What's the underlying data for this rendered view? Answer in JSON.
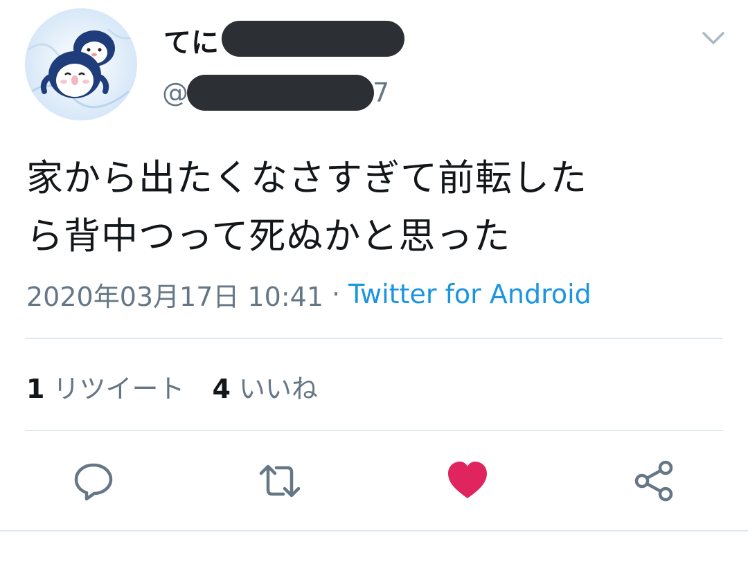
{
  "author": {
    "display_name_visible": "てに",
    "handle_prefix": "@",
    "handle_suffix_visible": "7",
    "avatar_icon": "penguin-avatar-icon"
  },
  "menu_icon": "chevron-down-icon",
  "tweet": {
    "text_line1": "家から出たくなさすぎて前転した",
    "text_line2": "ら背中つって死ぬかと思った",
    "timestamp": "2020年03月17日 10:41",
    "separator": "·",
    "source": "Twitter for Android"
  },
  "stats": {
    "retweets_count": "1",
    "retweets_label": "リツイート",
    "likes_count": "4",
    "likes_label": "いいね"
  },
  "actions": [
    {
      "name": "reply",
      "icon": "reply-icon",
      "active": false
    },
    {
      "name": "retweet",
      "icon": "retweet-icon",
      "active": false
    },
    {
      "name": "like",
      "icon": "heart-icon",
      "active": true
    },
    {
      "name": "share",
      "icon": "share-icon",
      "active": false
    }
  ],
  "colors": {
    "text_primary": "#14171a",
    "text_secondary": "#657786",
    "link": "#1b95e0",
    "like_active": "#e0245e",
    "icon_default": "#657786",
    "divider": "#e1e8ed",
    "redaction": "#2c2f33"
  }
}
